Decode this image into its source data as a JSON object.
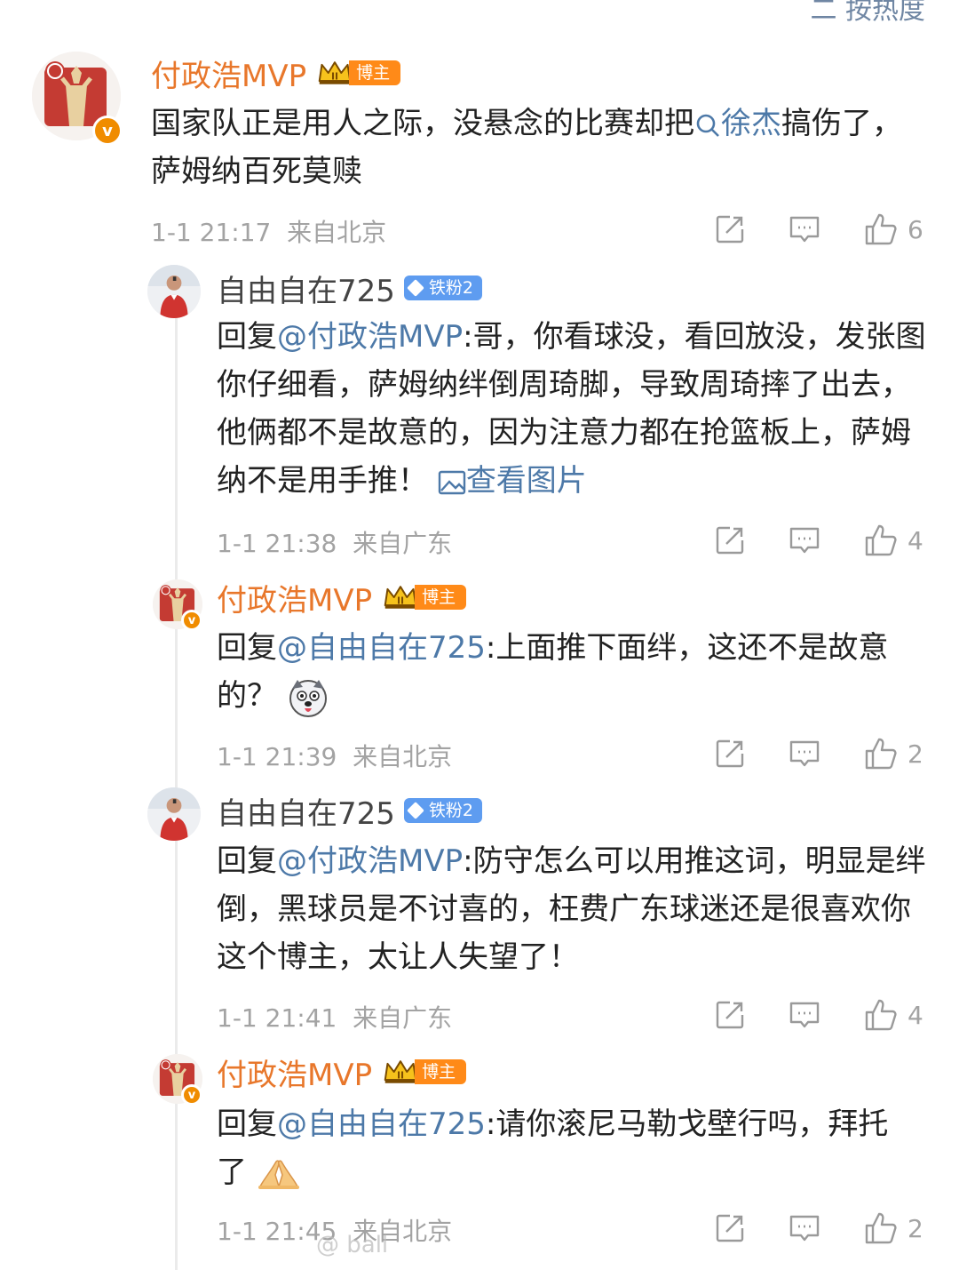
{
  "sort_label": "二 按热度",
  "comments": [
    {
      "name": "付政浩MVP",
      "badge": "博主",
      "text_before": "国家队正是用人之际，没悬念的比赛却把",
      "link": "徐杰",
      "text_after": "搞伤了，萨姆纳百死莫赎",
      "time": "1-1 21:17",
      "location": "来自北京",
      "likes": "6"
    },
    {
      "name": "自由自在725",
      "badge": "铁粉2",
      "reply_prefix": "回复",
      "mention": "@付政浩MVP",
      "text": ":哥，你看球没，看回放没，发张图你仔细看，萨姆纳绊倒周琦脚，导致周琦摔了出去，他俩都不是故意的，因为注意力都在抢篮板上，萨姆纳不是用手推！",
      "image_link": "查看图片",
      "time": "1-1 21:38",
      "location": "来自广东",
      "likes": "4"
    },
    {
      "name": "付政浩MVP",
      "badge": "博主",
      "reply_prefix": "回复",
      "mention": "@自由自在725",
      "text": ":上面推下面绊，这还不是故意的？",
      "time": "1-1 21:39",
      "location": "来自北京",
      "likes": "2"
    },
    {
      "name": "自由自在725",
      "badge": "铁粉2",
      "reply_prefix": "回复",
      "mention": "@付政浩MVP",
      "text": ":防守怎么可以用推这词，明显是绊倒，黑球员是不讨喜的，枉费广东球迷还是很喜欢你这个博主，太让人失望了！",
      "time": "1-1 21:41",
      "location": "来自广东",
      "likes": "4"
    },
    {
      "name": "付政浩MVP",
      "badge": "博主",
      "reply_prefix": "回复",
      "mention": "@自由自在725",
      "text": ":请你滚尼马勒戈壁行吗，拜托了",
      "time": "1-1 21:45",
      "location": "来自北京",
      "likes": "2"
    }
  ],
  "watermark": "@ ball",
  "colors": {
    "accent_link": "#4d79a8",
    "blogger_name": "#e8772b",
    "blogger_tag": "#ff8a18",
    "fan_tag": "#5e9cf0",
    "meta": "#a3a3a3"
  },
  "icons": [
    "repost-icon",
    "comment-icon",
    "like-icon",
    "search-icon",
    "image-icon",
    "crown-icon",
    "verified-icon",
    "dog-emoji-icon",
    "pray-emoji-icon"
  ]
}
